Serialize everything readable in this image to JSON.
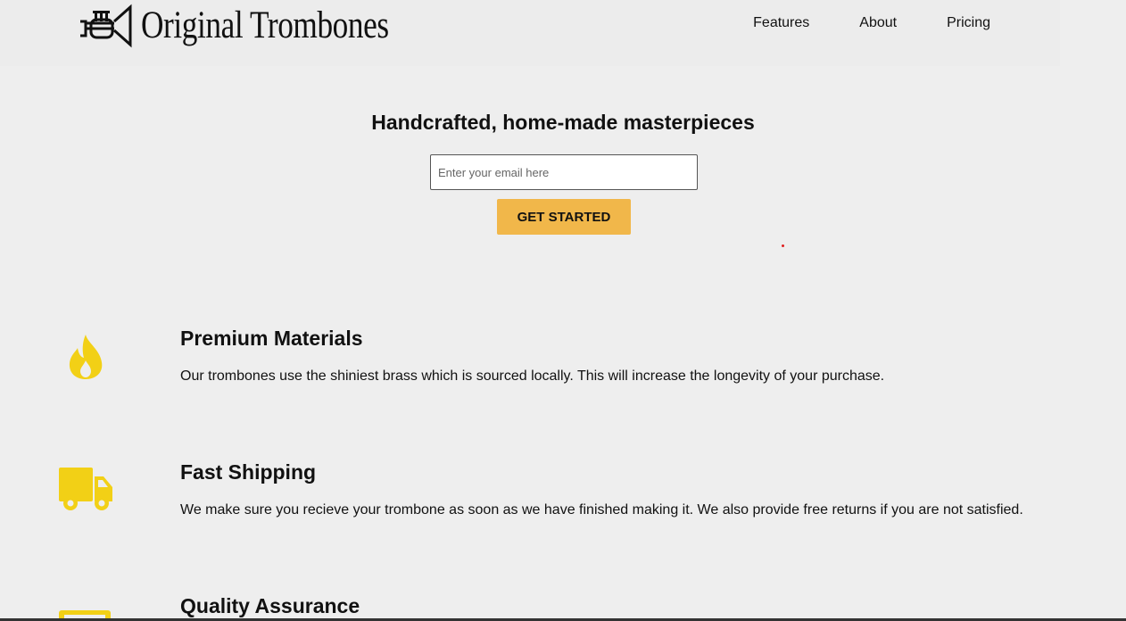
{
  "header": {
    "logo_text": "Original Trombones",
    "nav": [
      "Features",
      "About",
      "Pricing"
    ]
  },
  "hero": {
    "title": "Handcrafted, home-made masterpieces",
    "email_placeholder": "Enter your email here",
    "cta_label": "GET STARTED"
  },
  "features": [
    {
      "icon": "fire-icon",
      "title": "Premium Materials",
      "text": "Our trombones use the shiniest brass which is sourced locally. This will increase the longevity of your purchase."
    },
    {
      "icon": "truck-icon",
      "title": "Fast Shipping",
      "text": "We make sure you recieve your trombone as soon as we have finished making it. We also provide free returns if you are not satisfied."
    },
    {
      "icon": "battery-icon",
      "title": "Quality Assurance",
      "text": ""
    }
  ],
  "colors": {
    "accent": "#f1b74a",
    "icon": "#f2d016",
    "background": "#eeeeee"
  }
}
